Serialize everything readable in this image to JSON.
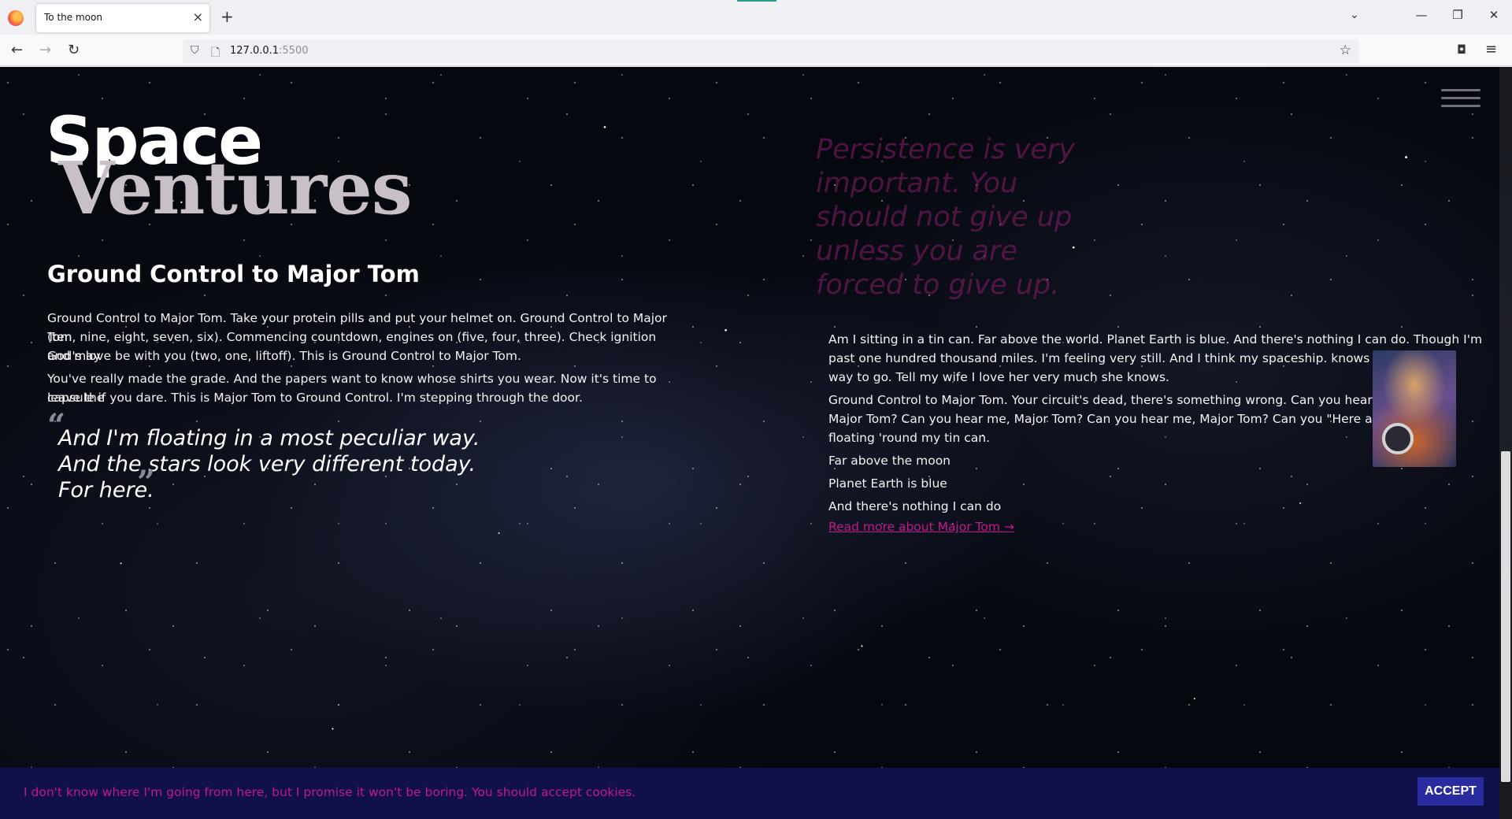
{
  "browser": {
    "tab_title": "To the moon",
    "tab_close": "×",
    "new_tab": "+",
    "tab_list": "⌄",
    "minimize": "—",
    "restore": "❐",
    "close": "✕",
    "back": "←",
    "forward": "→",
    "reload": "↻",
    "url_host": "127.0.0.1",
    "url_port": ":5500",
    "shield_icon": "⛉",
    "page_icon": "🗋",
    "star_icon": "☆",
    "pocket_icon": "◘",
    "menu_icon": "≡"
  },
  "page": {
    "logo": {
      "line1": "Space",
      "line2": "Ventures"
    },
    "title": "Ground Control to Major Tom",
    "paragraphs": [
      "Ground Control to Major Tom. Take your protein pills and put your helmet on. Ground Control to Major Tom",
      "(ten, nine, eight, seven, six). Commencing countdown, engines on (five, four, three). Check ignition and may",
      "God's love be with you (two, one, liftoff). This is Ground Control to Major Tom.",
      "You've really made the grade. And the papers want to know whose shirts you wear. Now it's time to leave the",
      "capsule if you dare. This is Major Tom to Ground Control. I'm stepping through the door."
    ],
    "quote": {
      "open": "“",
      "close": "”",
      "lines": [
        "And I'm floating in a most peculiar way.",
        "And the stars look very different today.",
        "For here."
      ]
    },
    "faded_quote": "Persistence is very important. You should not give up unless you are forced to give up.",
    "right_lines": [
      "Am I sitting in a tin can. Far above the world. Planet Earth is blue. And there's nothing I can do. Though I'm",
      "past one hundred thousand miles. I'm feeling very still. And I think my spaceship. knows which",
      "way to go. Tell my wife I love her very much she knows.",
      "Ground Control to Major Tom. Your circuit's dead, there's something wrong. Can you hear me,",
      "Major Tom? Can you hear me, Major Tom? Can you hear me, Major Tom? Can you \"Here am I",
      "floating 'round my tin can.",
      "Far above the moon",
      "Planet Earth is blue",
      "And there's nothing I can do"
    ],
    "read_more": "Read more about Major Tom →",
    "cookie": {
      "text": "I don't know where I'm going from here, but I promise it won't be boring. You should accept cookies.",
      "button": "ACCEPT"
    }
  },
  "colors": {
    "accent_pink": "#c2188e",
    "cookie_bg": "#10104a",
    "accept_bg": "#2b2ba0"
  }
}
